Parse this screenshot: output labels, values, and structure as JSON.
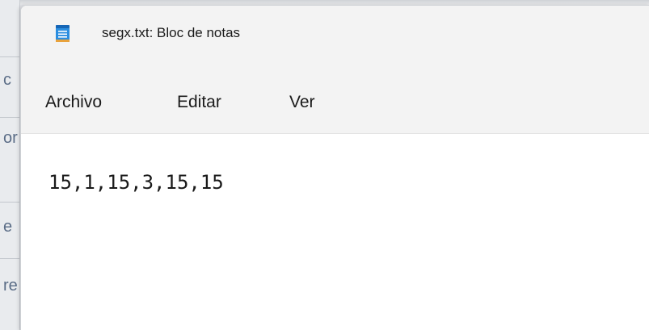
{
  "window": {
    "title": "segx.txt: Bloc de notas",
    "app_icon": "notepad-icon"
  },
  "menu": {
    "items": [
      {
        "label": "Archivo"
      },
      {
        "label": "Editar"
      },
      {
        "label": "Ver"
      }
    ]
  },
  "editor": {
    "content": "15,1,15,3,15,15"
  },
  "background_window": {
    "visible_fragments": [
      "c",
      "or",
      "e",
      "re"
    ]
  },
  "colors": {
    "titlebar_bg": "#f3f3f3",
    "editor_bg": "#ffffff",
    "text": "#1a1a1a",
    "icon_blue": "#1f7fd1"
  }
}
